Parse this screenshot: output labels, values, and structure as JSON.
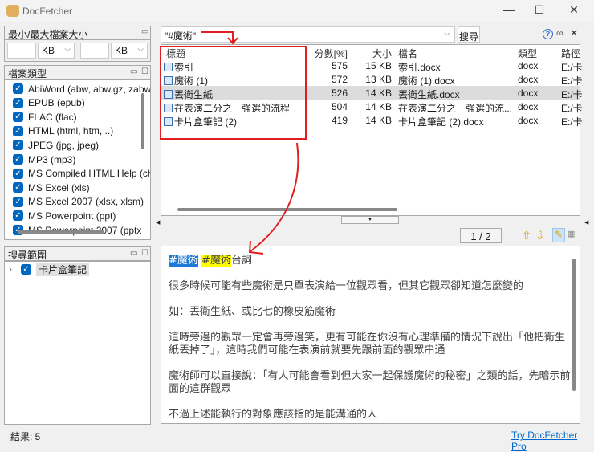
{
  "window": {
    "title": "DocFetcher",
    "minimize": "—",
    "maximize": "☐",
    "close": "✕"
  },
  "size_panel": {
    "title": "最小/最大檔案大小",
    "min_value": "",
    "min_unit": "KB",
    "max_value": "",
    "max_unit": "KB"
  },
  "types_panel": {
    "title": "檔案類型",
    "items": [
      "AbiWord (abw, abw.gz, zabw)",
      "EPUB (epub)",
      "FLAC (flac)",
      "HTML (html, htm, ..)",
      "JPEG (jpg, jpeg)",
      "MP3 (mp3)",
      "MS Compiled HTML Help (chm)",
      "MS Excel (xls)",
      "MS Excel 2007 (xlsx, xlsm)",
      "MS Powerpoint (ppt)",
      "MS Powerpoint 2007 (pptx"
    ]
  },
  "scope_panel": {
    "title": "搜尋範圍",
    "items": [
      "卡片盒筆記"
    ]
  },
  "search": {
    "query": "\"#魔術\"",
    "button": "搜尋"
  },
  "table": {
    "headers": {
      "title": "標題",
      "score": "分數[%]",
      "size": "大小",
      "filename": "檔名",
      "type": "類型",
      "path": "路徑"
    },
    "rows": [
      {
        "title": "索引",
        "score": "575",
        "size": "15 KB",
        "filename": "索引.docx",
        "type": "docx",
        "path": "E:/卡"
      },
      {
        "title": "魔術 (1)",
        "score": "572",
        "size": "13 KB",
        "filename": "魔術 (1).docx",
        "type": "docx",
        "path": "E:/卡"
      },
      {
        "title": "丟衛生紙",
        "score": "526",
        "size": "14 KB",
        "filename": "丟衛生紙.docx",
        "type": "docx",
        "path": "E:/卡"
      },
      {
        "title": "在表演二分之一強選的流程",
        "score": "504",
        "size": "14 KB",
        "filename": "在表演二分之一強選的流...",
        "type": "docx",
        "path": "E:/卡"
      },
      {
        "title": "卡片盒筆記 (2)",
        "score": "419",
        "size": "14 KB",
        "filename": "卡片盒筆記 (2).docx",
        "type": "docx",
        "path": "E:/卡"
      }
    ]
  },
  "preview": {
    "page": "1 / 2",
    "heading_hl1": "#魔術",
    "heading_hl2": "#魔術",
    "heading_rest": "台詞",
    "paragraphs": [
      "很多時候可能有些魔術是只單表演給一位觀眾看，但其它觀眾卻知道怎麼變的",
      "如：丟衛生紙、或比七的橡皮筋魔術",
      "這時旁邊的觀眾一定會再旁邊笑，更有可能在你沒有心理準備的情況下說出「他把衛生紙丟掉了」，這時我們可能在表演前就要先跟前面的觀眾串通",
      "魔術師可以直接說：「有人可能會看到但大家一起保護魔術的秘密」之類的話，先暗示前面的這群觀眾",
      "不過上述能執行的對象應該指的是能溝通的人"
    ]
  },
  "status": {
    "results": "結果: 5",
    "pro_link": "Try DocFetcher Pro"
  },
  "colors": {
    "accent": "#0067c0",
    "annotation": "#e02020",
    "highlight_selected": "#1e78d6",
    "highlight": "#ffff00"
  }
}
